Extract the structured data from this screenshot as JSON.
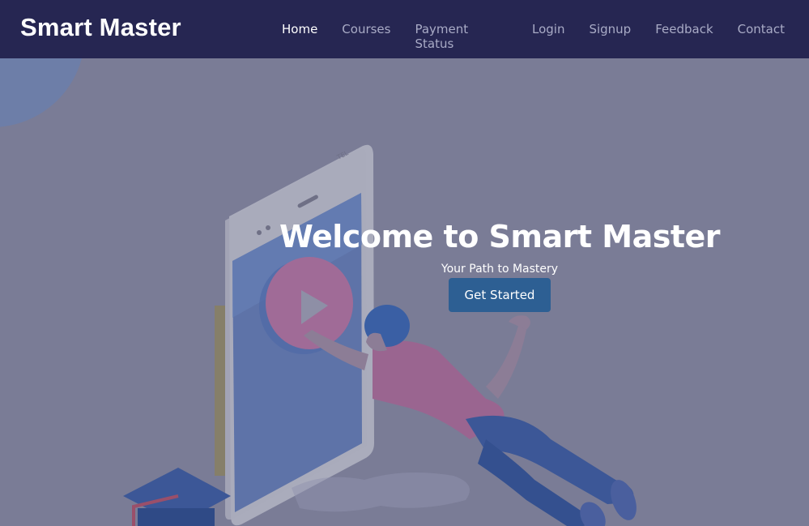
{
  "brand": {
    "name": "Smart Master"
  },
  "nav": {
    "items": [
      {
        "label": "Home",
        "active": true
      },
      {
        "label": "Courses",
        "active": false
      },
      {
        "label": "Payment Status",
        "active": false
      },
      {
        "label": "Login",
        "active": false
      },
      {
        "label": "Signup",
        "active": false
      },
      {
        "label": "Feedback",
        "active": false
      },
      {
        "label": "Contact",
        "active": false
      }
    ]
  },
  "hero": {
    "title": "Welcome to Smart Master",
    "subtitle": "Your Path to Mastery",
    "cta_label": "Get Started",
    "illustration": "student-with-phone-video-illustration"
  },
  "colors": {
    "navbar": "#262652",
    "hero_bg": "#7a7c96",
    "cta": "#2d5f93",
    "nav_active": "#ffffff",
    "nav_inactive": "#a9abc6"
  }
}
